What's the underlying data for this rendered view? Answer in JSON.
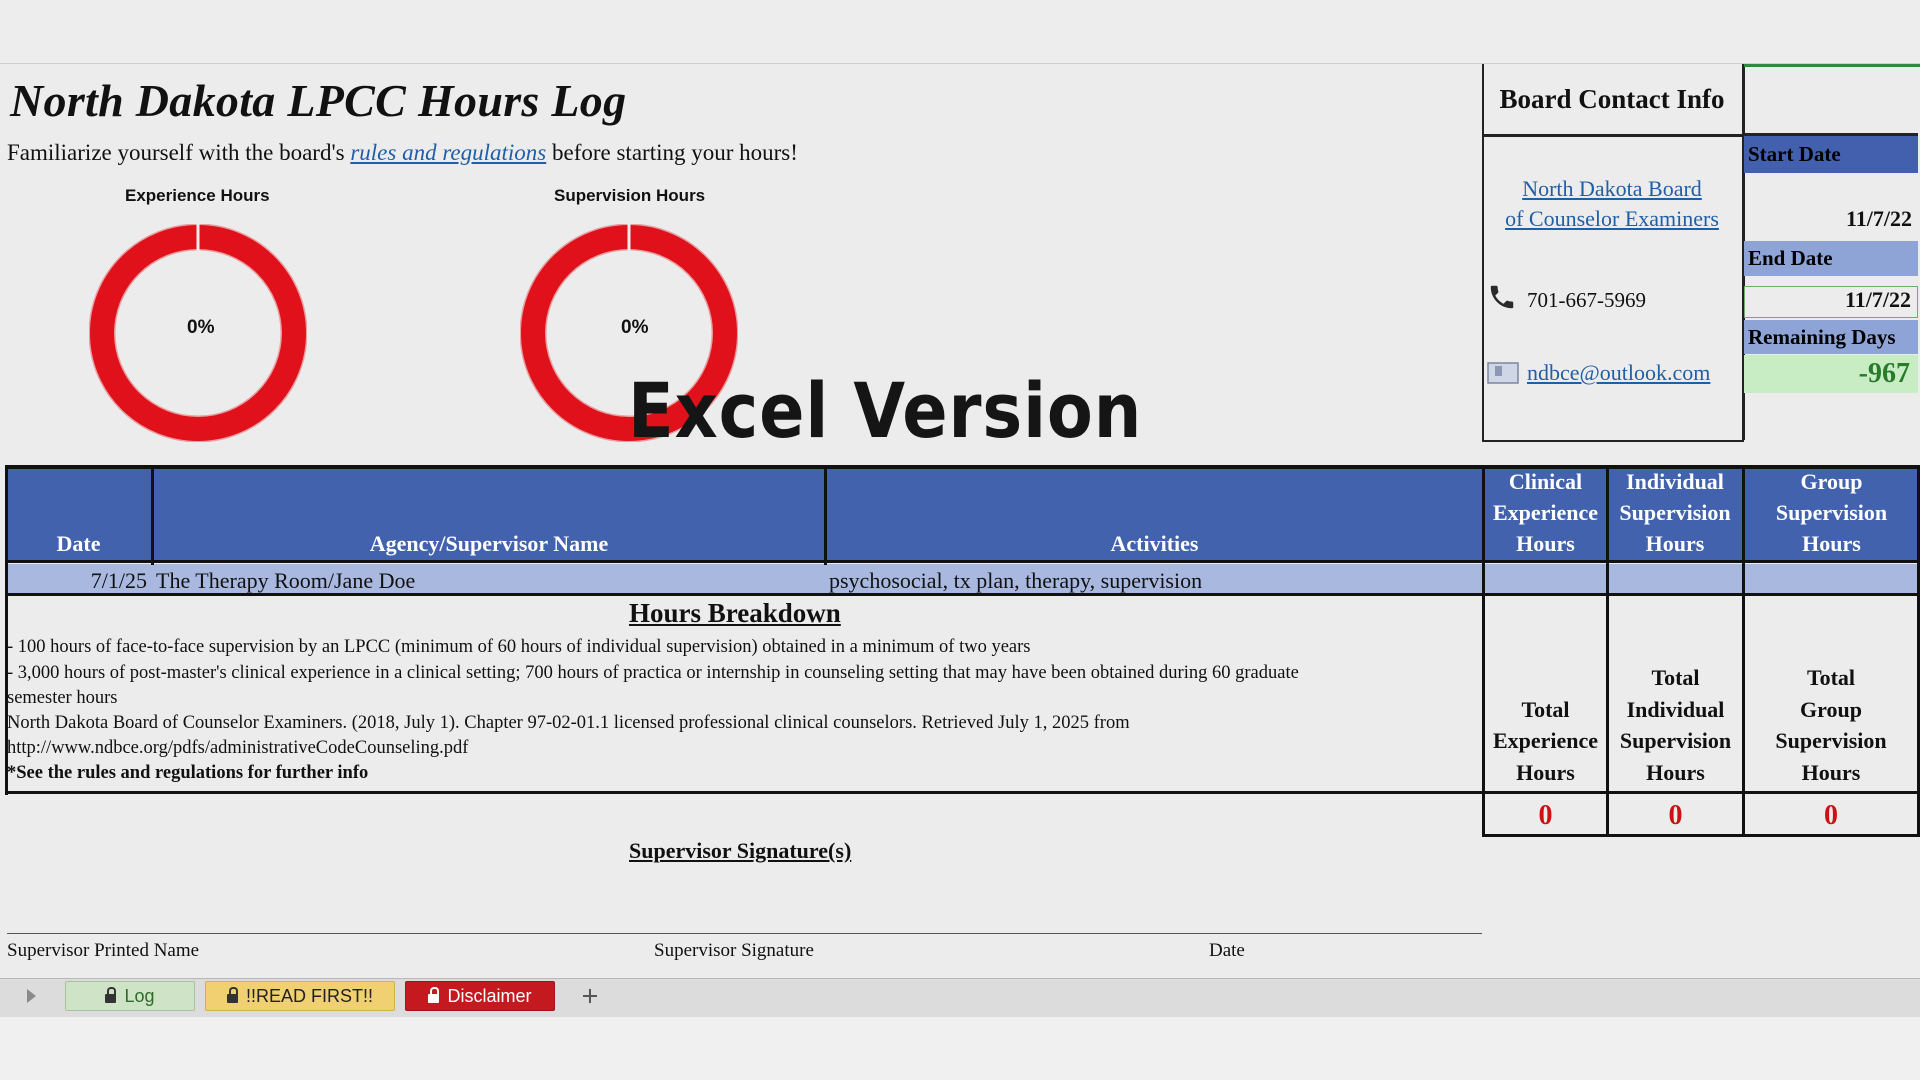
{
  "title": "North Dakota LPCC Hours Log",
  "intro": {
    "before": "Familiarize yourself with the board's",
    "link": "rules and regulations",
    "after": "before starting your hours!"
  },
  "charts": [
    {
      "label": "Experience Hours",
      "percent_text": "0%",
      "completed_fraction": 0
    },
    {
      "label": "Supervision Hours",
      "percent_text": "0%",
      "completed_fraction": 0
    }
  ],
  "watermark": "Excel Version",
  "contact": {
    "heading": "Board Contact Info",
    "org_line1": "North Dakota Board",
    "org_line2": "of Counselor Examiners",
    "phone": "701-667-5969",
    "email": "ndbce@outlook.com"
  },
  "dates": {
    "start_label": "Start Date",
    "start_value": "11/7/22",
    "end_label": "End Date",
    "end_value": "11/7/22",
    "remaining_label": "Remaining Days",
    "remaining_value": "-967"
  },
  "table": {
    "headers": {
      "date": "Date",
      "agency": "Agency/Supervisor Name",
      "activities": "Activities",
      "clinical": [
        "Clinical",
        "Experience",
        "Hours"
      ],
      "individual": [
        "Individual",
        "Supervision",
        "Hours"
      ],
      "group": [
        "Group",
        "Supervision",
        "Hours"
      ]
    },
    "rows": [
      {
        "date": "7/1/25",
        "agency": "The Therapy Room/Jane Doe",
        "activities": "psychosocial, tx plan, therapy, supervision"
      }
    ]
  },
  "breakdown": {
    "title": "Hours Breakdown",
    "lines": [
      "- 100 hours of face-to-face supervision by an LPCC (minimum of 60 hours of individual supervision) obtained in a minimum of two years",
      "- 3,000 hours of post-master's clinical experience in a clinical setting; 700 hours of practica or internship in counseling setting that may have been obtained during 60 graduate",
      "semester hours",
      "North Dakota Board of Counselor Examiners. (2018, July 1). Chapter 97-02-01.1 licensed professional clinical counselors. Retrieved July 1, 2025 from",
      "http://www.ndbce.org/pdfs/administrativeCodeCounseling.pdf"
    ],
    "note": "*See the rules and regulations for further info"
  },
  "totals": {
    "experience": [
      "Total",
      "Experience",
      "Hours"
    ],
    "individual": [
      "Total",
      "Individual",
      "Supervision",
      "Hours"
    ],
    "group": [
      "Total",
      "Group",
      "Supervision",
      "Hours"
    ],
    "values": [
      "0",
      "0",
      "0"
    ]
  },
  "signature": {
    "title": "Supervisor Signature(s)",
    "printed_name": "Supervisor Printed Name",
    "signature": "Supervisor Signature",
    "date": "Date"
  },
  "tabs": [
    {
      "label": "Log",
      "locked": true
    },
    {
      "label": "!!READ FIRST!!",
      "locked": true
    },
    {
      "label": "Disclaimer",
      "locked": true
    }
  ],
  "colors": {
    "header_blue": "#4262ad",
    "row_blue": "#a9b8de",
    "donut_red": "#e0121b",
    "total_red": "#cc1111",
    "remaining_green": "#2a7a2a",
    "link_blue": "#1f5fa8"
  }
}
